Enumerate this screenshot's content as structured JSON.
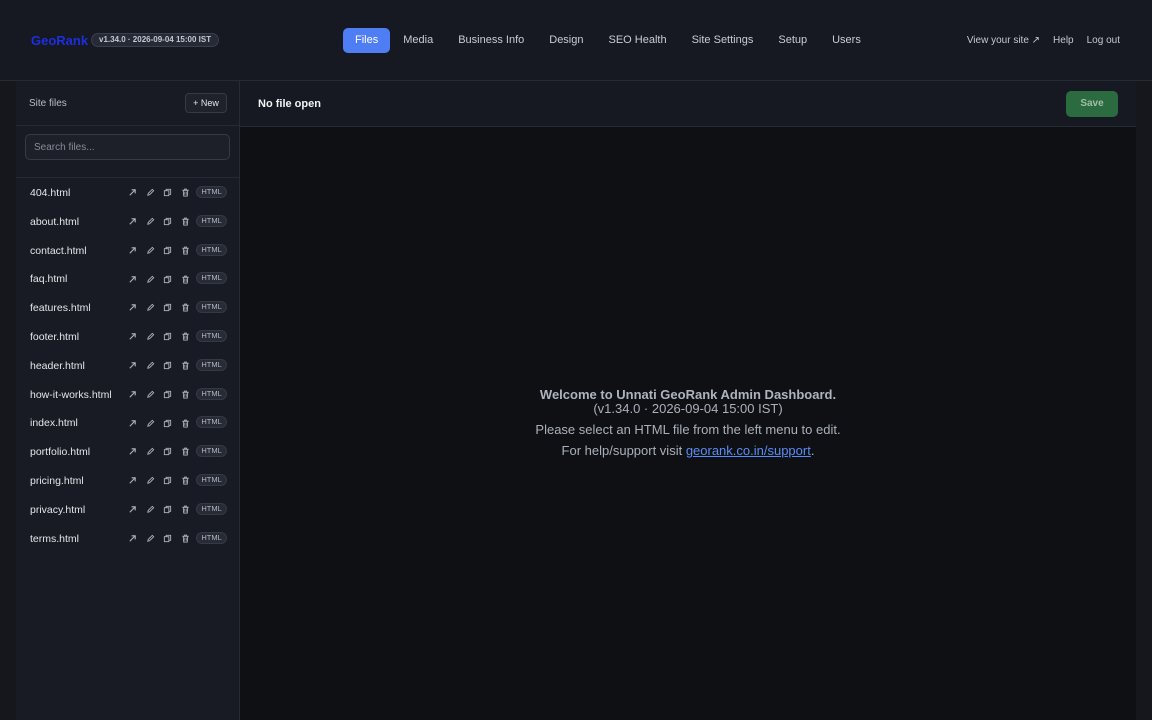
{
  "header": {
    "brand": "GeoRank",
    "version": "v1.34.0 · 2026-09-04 15:00 IST",
    "nav": [
      {
        "label": "Files",
        "active": true
      },
      {
        "label": "Media"
      },
      {
        "label": "Business Info"
      },
      {
        "label": "Design"
      },
      {
        "label": "SEO Health"
      },
      {
        "label": "Site Settings"
      },
      {
        "label": "Setup"
      },
      {
        "label": "Users"
      }
    ],
    "links": {
      "view_site": "View your site ↗",
      "help": "Help",
      "logout": "Log out"
    }
  },
  "sidebar": {
    "title": "Site files",
    "new_label": "+ New",
    "search_placeholder": "Search files...",
    "files": [
      {
        "name": "404.html",
        "type": "HTML"
      },
      {
        "name": "about.html",
        "type": "HTML"
      },
      {
        "name": "contact.html",
        "type": "HTML"
      },
      {
        "name": "faq.html",
        "type": "HTML"
      },
      {
        "name": "features.html",
        "type": "HTML"
      },
      {
        "name": "footer.html",
        "type": "HTML"
      },
      {
        "name": "header.html",
        "type": "HTML"
      },
      {
        "name": "how-it-works.html",
        "type": "HTML"
      },
      {
        "name": "index.html",
        "type": "HTML"
      },
      {
        "name": "portfolio.html",
        "type": "HTML"
      },
      {
        "name": "pricing.html",
        "type": "HTML"
      },
      {
        "name": "privacy.html",
        "type": "HTML"
      },
      {
        "name": "terms.html",
        "type": "HTML"
      }
    ],
    "action_icons": [
      "external-link-icon",
      "pencil-icon",
      "copy-icon",
      "trash-icon"
    ]
  },
  "editor": {
    "title": "No file open",
    "save_label": "Save",
    "welcome": {
      "line1": "Welcome to Unnati GeoRank Admin Dashboard.",
      "line2": "(v1.34.0 · 2026-09-04 15:00 IST)",
      "line3": "Please select an HTML file from the left menu to edit.",
      "line4_prefix": "For help/support visit ",
      "link_text": "georank.co.in/support",
      "line4_suffix": "."
    }
  },
  "colors": {
    "accent": "#4f7df3",
    "brand": "#1d2ee0",
    "save": "#2c6b3f",
    "link": "#5b8cf5"
  }
}
